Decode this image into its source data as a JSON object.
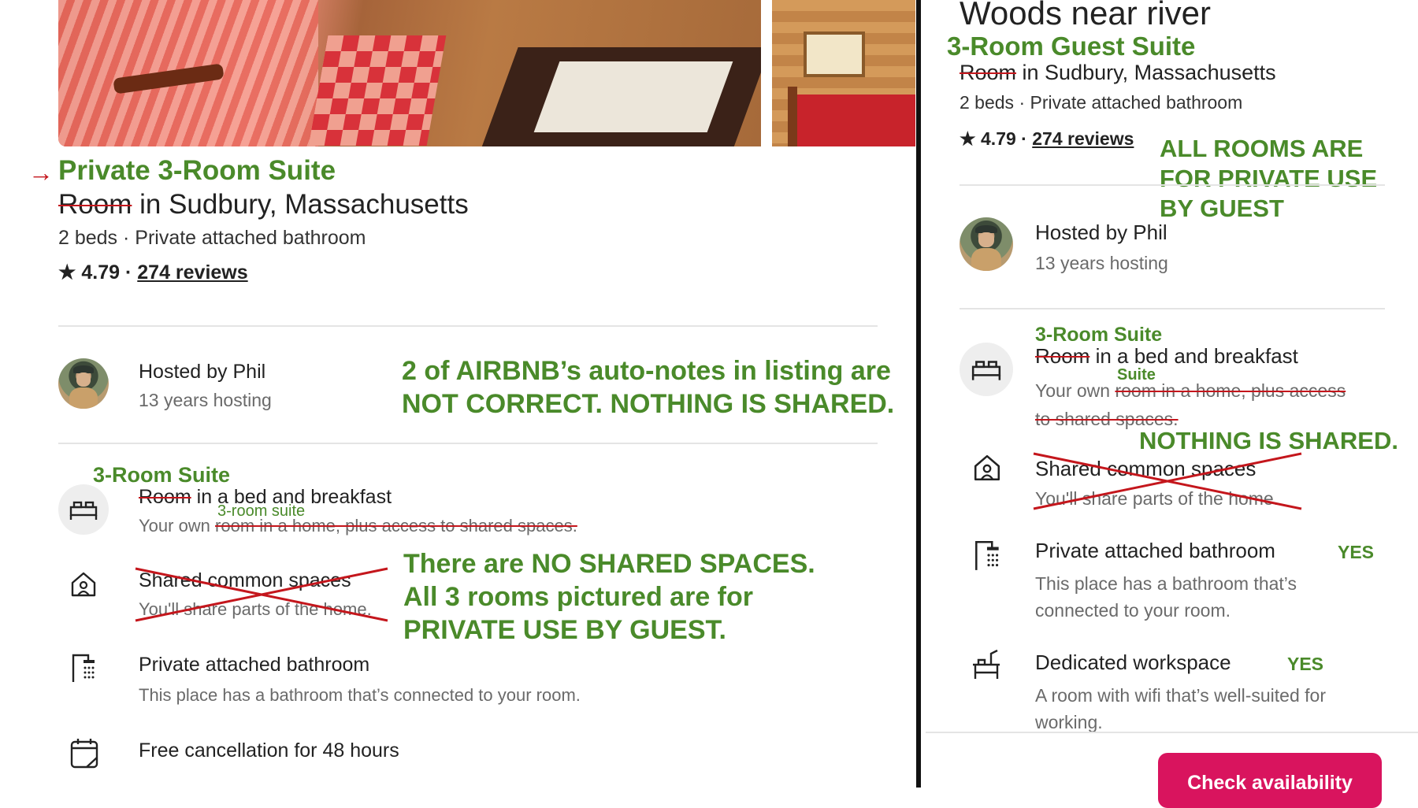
{
  "left": {
    "title_annotation": "Private 3-Room Suite",
    "title_struck": "Room",
    "title_rest": " in Sudbury, Massachusetts",
    "subtitle": "2 beds · Private attached bathroom",
    "rating": "4.79",
    "rating_sep": " · ",
    "reviews_link": "274 reviews",
    "host_name": "Hosted by Phil",
    "host_years": "13 years hosting",
    "note_autonotes": "2 of AIRBNB’s auto-notes in listing are NOT CORRECT.  NOTHING IS SHARED.",
    "feature1": {
      "annotation": "3-Room Suite",
      "struck": "Room",
      "rest": " in a bed and breakfast",
      "sub_prefix": "Your own ",
      "sub_annotation": "3-room suite",
      "sub_struck": "room in a home, plus access to shared spaces."
    },
    "feature2": {
      "title": "Shared common spaces",
      "sub": "You'll share parts of the home."
    },
    "note_no_shared": "There are NO SHARED SPACES. All 3 rooms pictured are for PRIVATE USE BY GUEST.",
    "feature3": {
      "title": "Private attached bathroom",
      "sub": "This place has a bathroom that’s connected to your room."
    },
    "feature4": {
      "title": "Free cancellation for 48 hours"
    }
  },
  "right": {
    "heading": "Woods near river",
    "title_annotation": "3-Room Guest Suite",
    "title_struck": "Room",
    "title_rest": " in Sudbury, Massachusetts",
    "subtitle": "2 beds · Private attached bathroom",
    "rating": "4.79",
    "rating_sep": " · ",
    "reviews_link": "274 reviews",
    "note_private": "ALL ROOMS ARE FOR PRIVATE USE BY GUEST",
    "host_name": "Hosted by Phil",
    "host_years": "13 years hosting",
    "feature1": {
      "annotation": "3-Room Suite",
      "struck": "Room",
      "rest": " in a bed and breakfast",
      "sub_prefix": "Your own ",
      "sub_annotation": "Suite",
      "sub_struck_1": "room in a home, plus access",
      "sub_struck_2": "to shared spaces."
    },
    "note_nothing_shared": "NOTHING IS SHARED.",
    "feature2": {
      "title": "Shared common spaces",
      "sub": "You'll share parts of the home."
    },
    "feature3": {
      "title": "Private attached bathroom",
      "yes": "YES",
      "sub": "This place has a bathroom that’s connected to your room."
    },
    "feature4": {
      "title": "Dedicated workspace",
      "yes": "YES",
      "sub": "A room with wifi that’s well-suited for working."
    },
    "cta": "Check availability"
  },
  "colors": {
    "annotation_green": "#4a8a2a",
    "annotation_red": "#c4161c",
    "cta_pink": "#d9145e"
  }
}
